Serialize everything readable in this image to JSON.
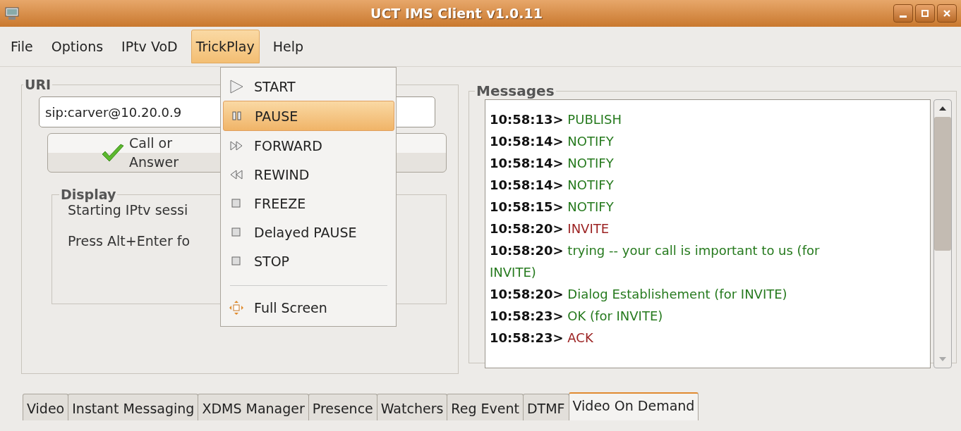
{
  "window": {
    "title": "UCT IMS Client v1.0.11"
  },
  "menubar": [
    {
      "label": "File",
      "selected": false
    },
    {
      "label": "Options",
      "selected": false
    },
    {
      "label": "IPtv VoD",
      "selected": false
    },
    {
      "label": "TrickPlay",
      "selected": true
    },
    {
      "label": "Help",
      "selected": false
    }
  ],
  "dropdown": [
    {
      "kind": "play",
      "label": "START",
      "selected": false
    },
    {
      "kind": "pause",
      "label": "PAUSE",
      "selected": true
    },
    {
      "kind": "forward",
      "label": "FORWARD",
      "selected": false
    },
    {
      "kind": "rewind",
      "label": "REWIND",
      "selected": false
    },
    {
      "kind": "square",
      "label": "FREEZE",
      "selected": false
    },
    {
      "kind": "square",
      "label": "Delayed PAUSE",
      "selected": false
    },
    {
      "kind": "square",
      "label": "STOP",
      "selected": false
    },
    {
      "kind": "separator"
    },
    {
      "kind": "fullscreen",
      "label": "Full Screen",
      "selected": false
    }
  ],
  "uri": {
    "title": "URI",
    "value": "sip:carver@10.20.0.9",
    "call_button": "Call or Answer"
  },
  "display": {
    "title": "Display",
    "lines": [
      "Starting IPtv sessi",
      "Press Alt+Enter fo"
    ]
  },
  "messages": {
    "title": "Messages",
    "items": [
      {
        "time": "10:58:13>",
        "text": "PUBLISH",
        "color": "#267a1e"
      },
      {
        "time": "10:58:14>",
        "text": "NOTIFY",
        "color": "#267a1e"
      },
      {
        "time": "10:58:14>",
        "text": "NOTIFY",
        "color": "#267a1e"
      },
      {
        "time": "10:58:14>",
        "text": "NOTIFY",
        "color": "#267a1e"
      },
      {
        "time": "10:58:15>",
        "text": "NOTIFY",
        "color": "#267a1e"
      },
      {
        "time": "10:58:20>",
        "text": "INVITE",
        "color": "#9a1f1f"
      },
      {
        "time": "10:58:20>",
        "text": "trying -- your call is important to us (for INVITE)",
        "color": "#267a1e"
      },
      {
        "time": "10:58:20>",
        "text": "Dialog Establishement (for INVITE)",
        "color": "#267a1e"
      },
      {
        "time": "10:58:23>",
        "text": "OK (for INVITE)",
        "color": "#267a1e"
      },
      {
        "time": "10:58:23>",
        "text": "ACK",
        "color": "#9a1f1f"
      }
    ]
  },
  "tabs": [
    {
      "label": "Video",
      "selected": false
    },
    {
      "label": "Instant Messaging",
      "selected": false
    },
    {
      "label": "XDMS Manager",
      "selected": false
    },
    {
      "label": "Presence",
      "selected": false
    },
    {
      "label": "Watchers",
      "selected": false
    },
    {
      "label": "Reg Event",
      "selected": false
    },
    {
      "label": "DTMF",
      "selected": false
    },
    {
      "label": "Video On Demand",
      "selected": true
    }
  ]
}
